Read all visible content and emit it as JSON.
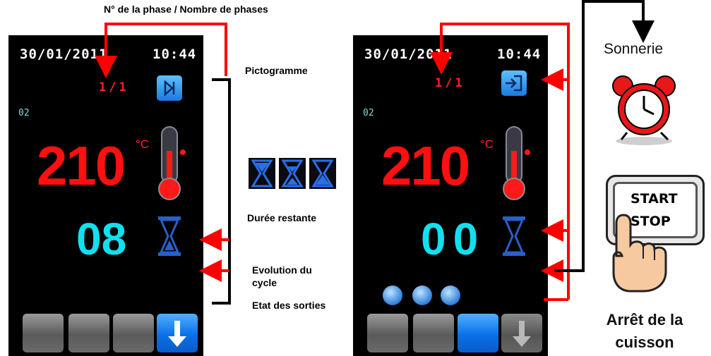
{
  "top_caption": "N° de la phase / Nombre de phases",
  "labels": {
    "pictogramme": "Pictogramme",
    "duree": "Durée restante",
    "evolution_line1": "Evolution du",
    "evolution_line2": "cycle",
    "etat": "Etat des sorties",
    "sonnerie": "Sonnerie",
    "arret_line1": "Arrêt de la",
    "arret_line2": "cuisson"
  },
  "left_screen": {
    "date": "30/01/2011",
    "time": "10:44",
    "phase": "1/1",
    "program": "02",
    "temperature": "210",
    "temp_unit": "°C",
    "remaining": "08"
  },
  "right_screen": {
    "date": "30/01/2011",
    "time": "10:44",
    "phase": "1/1",
    "program": "02",
    "temperature": "210",
    "temp_unit": "°C",
    "remaining": "00"
  },
  "start_stop": {
    "line1": "START",
    "line2": "STOP"
  },
  "colors": {
    "arrow": "#ff0000",
    "bracket": "#000000",
    "temperature": "#ff1010",
    "time": "#10e0f0"
  },
  "icons": {
    "left_pictogram": "phase-step-icon",
    "right_pictogram": "exit-icon",
    "hourglass": "hourglass-icon",
    "thermometer": "thermometer-icon",
    "alarm_clock": "alarm-clock-icon",
    "hand": "pointing-hand-icon",
    "outputs": [
      "fan-icon",
      "bell-icon",
      "valve-icon"
    ],
    "arrow_down": "arrow-down-icon"
  }
}
